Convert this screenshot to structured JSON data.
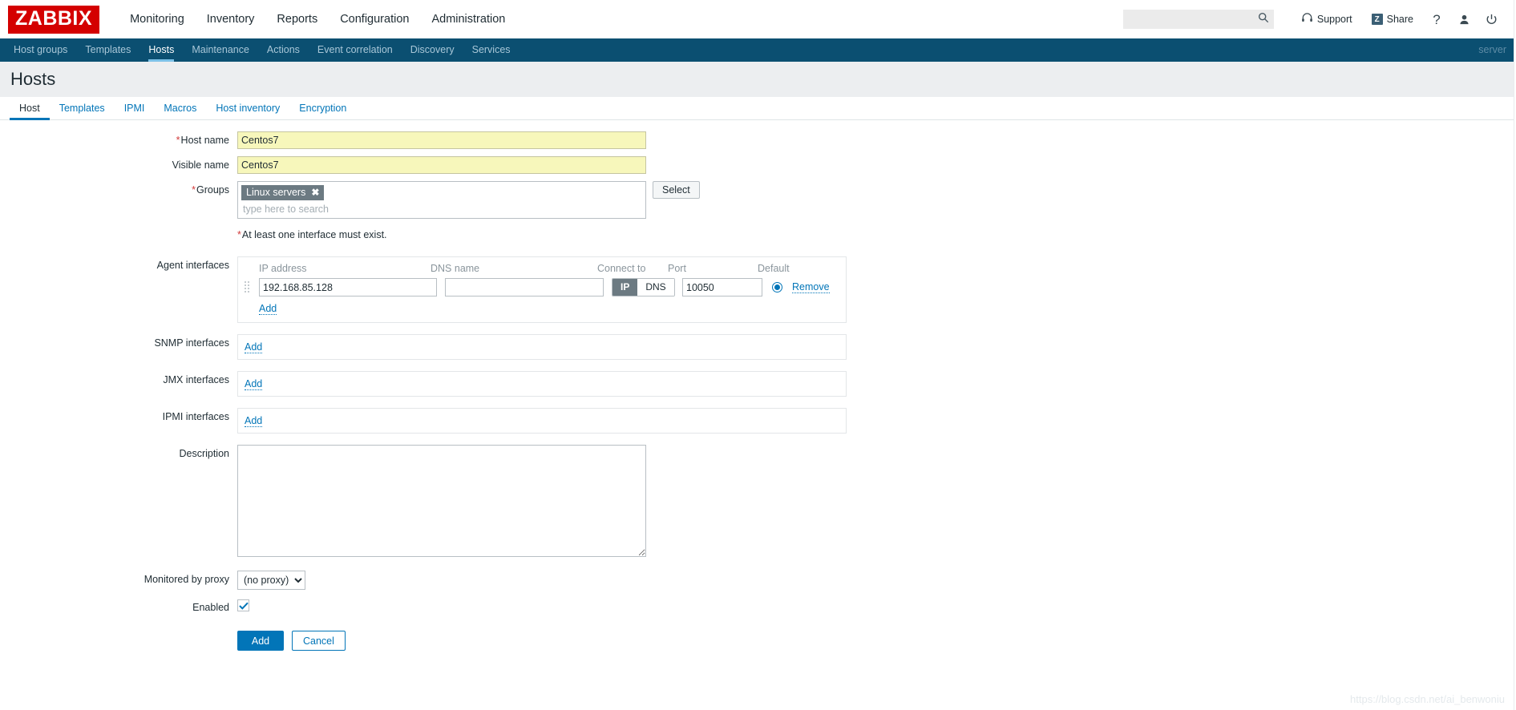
{
  "header": {
    "logo_text": "ZABBIX",
    "menu": [
      {
        "label": "Monitoring",
        "selected": false
      },
      {
        "label": "Inventory",
        "selected": false
      },
      {
        "label": "Reports",
        "selected": false
      },
      {
        "label": "Configuration",
        "selected": true
      },
      {
        "label": "Administration",
        "selected": false
      }
    ],
    "search": {
      "value": "",
      "placeholder": "",
      "icon": "search-icon"
    },
    "support_label": "Support",
    "support_icon": "headset-icon",
    "share_label": "Share",
    "share_badge": "Z",
    "help_icon": "question-mark-icon",
    "user_icon": "user-icon",
    "power_icon": "power-icon"
  },
  "subnav": {
    "items": [
      {
        "label": "Host groups",
        "selected": false
      },
      {
        "label": "Templates",
        "selected": false
      },
      {
        "label": "Hosts",
        "selected": true
      },
      {
        "label": "Maintenance",
        "selected": false
      },
      {
        "label": "Actions",
        "selected": false
      },
      {
        "label": "Event correlation",
        "selected": false
      },
      {
        "label": "Discovery",
        "selected": false
      },
      {
        "label": "Services",
        "selected": false
      }
    ],
    "server_label": "server"
  },
  "page": {
    "title": "Hosts"
  },
  "tabs": [
    {
      "label": "Host",
      "selected": true
    },
    {
      "label": "Templates",
      "selected": false
    },
    {
      "label": "IPMI",
      "selected": false
    },
    {
      "label": "Macros",
      "selected": false
    },
    {
      "label": "Host inventory",
      "selected": false
    },
    {
      "label": "Encryption",
      "selected": false
    }
  ],
  "form": {
    "host_name": {
      "label": "Host name",
      "required": true,
      "value": "Centos7"
    },
    "visible_name": {
      "label": "Visible name",
      "required": false,
      "value": "Centos7"
    },
    "groups": {
      "label": "Groups",
      "required": true,
      "chips": [
        "Linux servers"
      ],
      "chip_remove": "✖",
      "placeholder": "type here to search",
      "select_button": "Select"
    },
    "interface_hint": "At least one interface must exist.",
    "agent_interfaces": {
      "label": "Agent interfaces",
      "columns": [
        "IP address",
        "DNS name",
        "Connect to",
        "Port",
        "Default"
      ],
      "rows": [
        {
          "ip": "192.168.85.128",
          "dns": "",
          "connect_to": "IP",
          "connect_options": [
            "IP",
            "DNS"
          ],
          "port": "10050",
          "default_selected": true,
          "remove_label": "Remove"
        }
      ],
      "add_label": "Add"
    },
    "snmp_interfaces": {
      "label": "SNMP interfaces",
      "add_label": "Add"
    },
    "jmx_interfaces": {
      "label": "JMX interfaces",
      "add_label": "Add"
    },
    "ipmi_interfaces": {
      "label": "IPMI interfaces",
      "add_label": "Add"
    },
    "description": {
      "label": "Description",
      "value": "",
      "placeholder": ""
    },
    "monitored_by_proxy": {
      "label": "Monitored by proxy",
      "value": "(no proxy)",
      "options": [
        "(no proxy)"
      ]
    },
    "enabled": {
      "label": "Enabled",
      "checked": true
    },
    "buttons": {
      "submit": "Add",
      "cancel": "Cancel"
    }
  },
  "watermark": "https://blog.csdn.net/ai_benwoniu",
  "colors": {
    "logo_red": "#D40000",
    "nav_blue": "#0b4f71",
    "link_blue": "#0275b8",
    "highlight_yellow": "#f7f7bb",
    "chip_gray": "#6c7a82",
    "required_red": "#d23b3b"
  }
}
